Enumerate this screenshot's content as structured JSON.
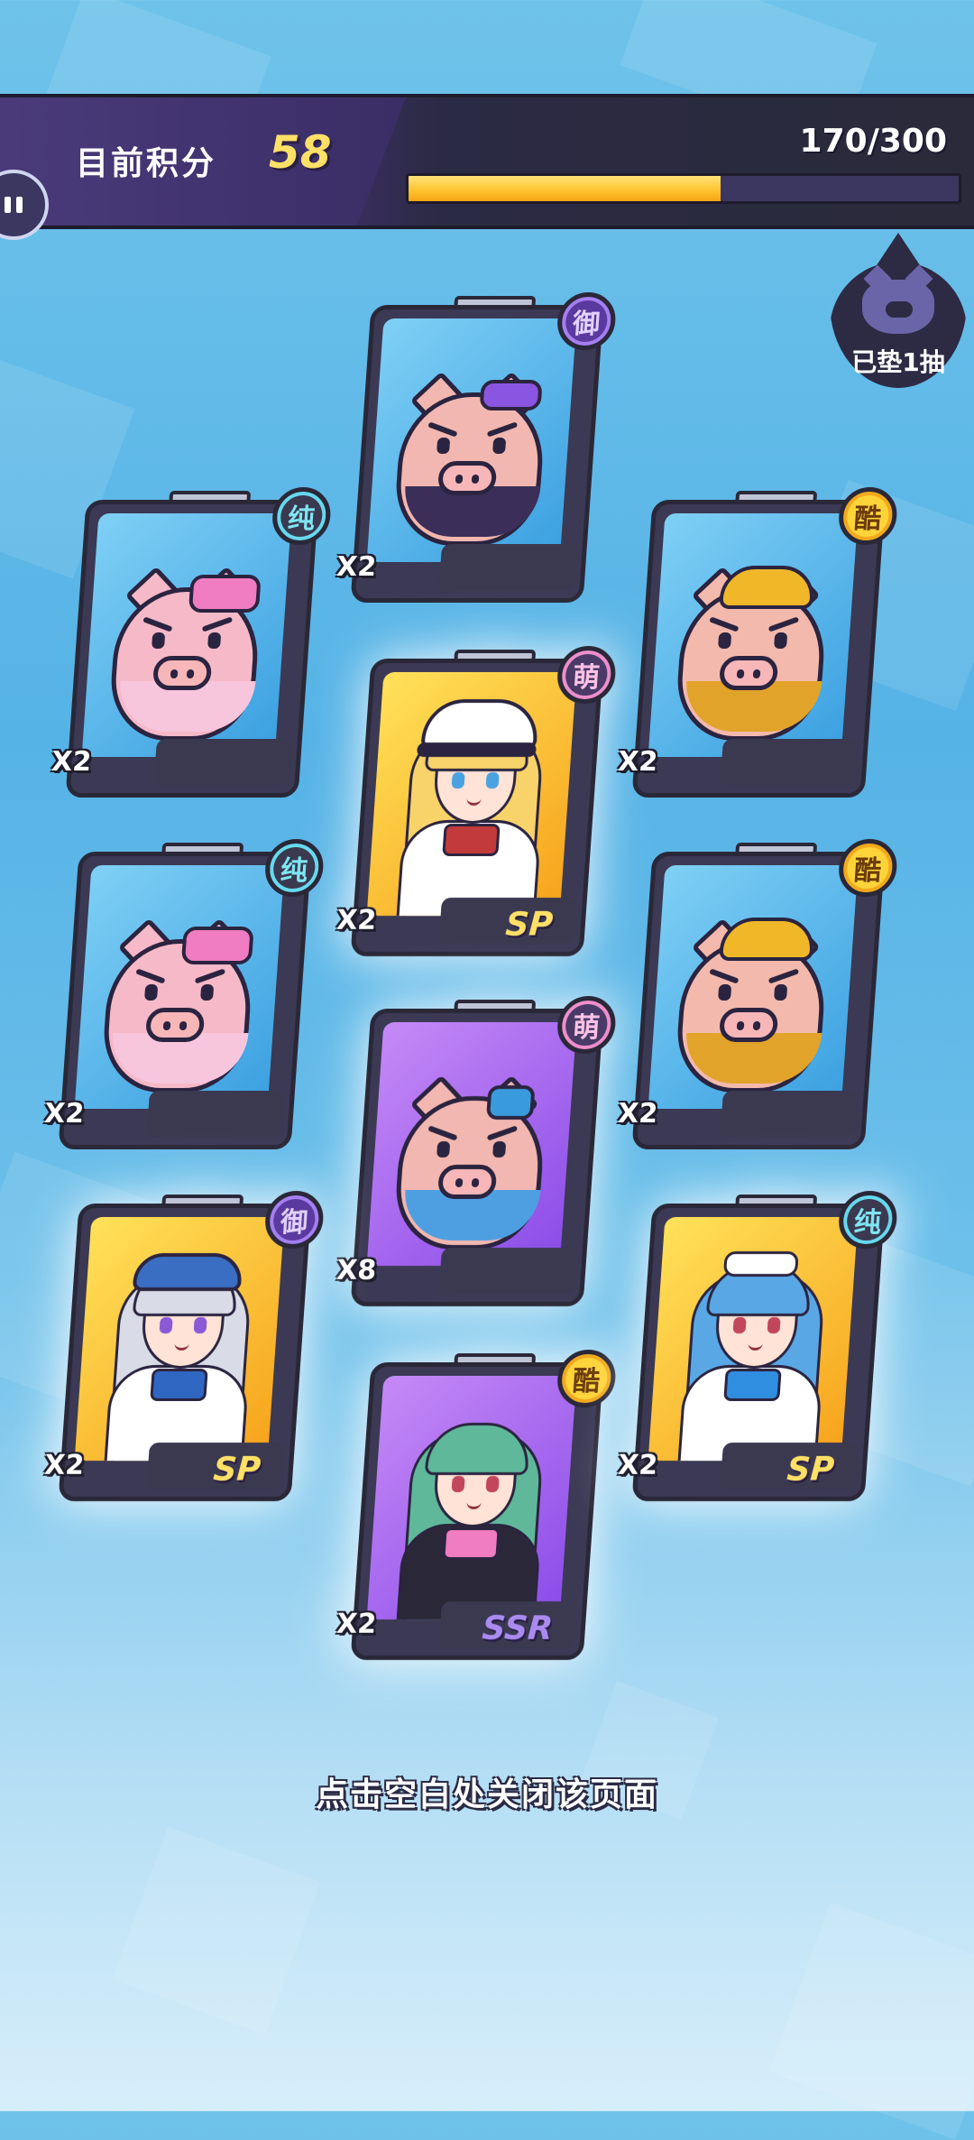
{
  "header": {
    "score_label": "目前积分",
    "score_value": "58",
    "progress_text": "170/300",
    "progress_fraction": 0.567
  },
  "pity_badge": {
    "label": "已垫1抽"
  },
  "cards": [
    {
      "id": "c1",
      "type": "pig",
      "variant": "shades",
      "bg": "blue",
      "tag": "御",
      "count": "X2",
      "rank": ""
    },
    {
      "id": "c2",
      "type": "pig",
      "variant": "bow",
      "bg": "blue",
      "tag": "纯",
      "count": "X2",
      "rank": ""
    },
    {
      "id": "c3",
      "type": "char",
      "variant": "captain",
      "bg": "gold",
      "tag": "萌",
      "count": "X2",
      "rank": "SP"
    },
    {
      "id": "c4",
      "type": "pig",
      "variant": "hat",
      "bg": "blue",
      "tag": "酷",
      "count": "X2",
      "rank": ""
    },
    {
      "id": "c5",
      "type": "pig",
      "variant": "bow",
      "bg": "blue",
      "tag": "纯",
      "count": "X2",
      "rank": ""
    },
    {
      "id": "c6",
      "type": "pig",
      "variant": "cap",
      "bg": "purple",
      "tag": "萌",
      "count": "X8",
      "rank": ""
    },
    {
      "id": "c7",
      "type": "pig",
      "variant": "hat",
      "bg": "blue",
      "tag": "酷",
      "count": "X2",
      "rank": ""
    },
    {
      "id": "c8",
      "type": "char",
      "variant": "beret",
      "bg": "gold",
      "tag": "御",
      "count": "X2",
      "rank": "SP"
    },
    {
      "id": "c9",
      "type": "char",
      "variant": "hoodie",
      "bg": "purple",
      "tag": "酷",
      "count": "X2",
      "rank": "SSR"
    },
    {
      "id": "c10",
      "type": "char",
      "variant": "maid",
      "bg": "gold",
      "tag": "纯",
      "count": "X2",
      "rank": "SP"
    }
  ],
  "close_hint": "点击空白处关闭该页面",
  "colors": {
    "progress_fill": "#ffc12c",
    "score_value": "#ffe066",
    "tag_chun": "#66d9ee",
    "tag_ku": "#ffd43a",
    "tag_yu": "#a57ff0",
    "tag_meng": "#ee8fcc"
  }
}
